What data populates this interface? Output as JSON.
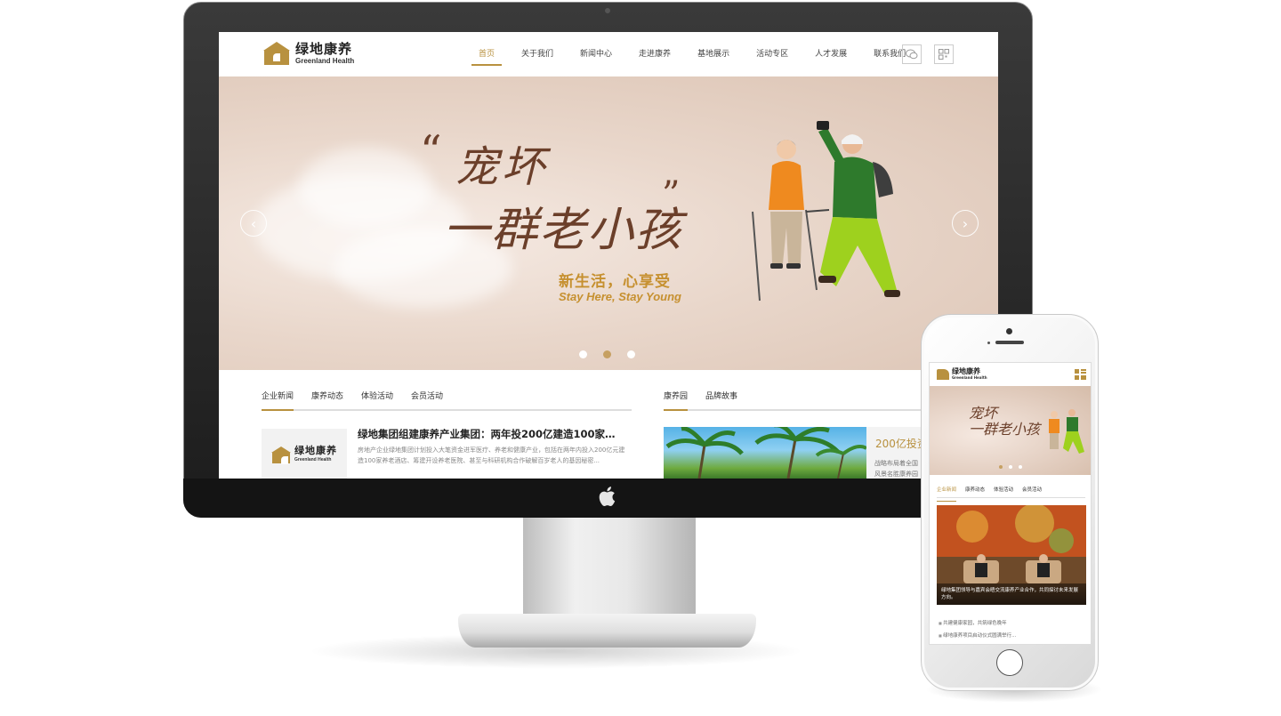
{
  "site": {
    "logo_cn": "绿地康养",
    "logo_en": "Greenland Health",
    "nav": [
      {
        "label": "首页",
        "active": true
      },
      {
        "label": "关于我们",
        "active": false
      },
      {
        "label": "新闻中心",
        "active": false
      },
      {
        "label": "走进康养",
        "active": false
      },
      {
        "label": "基地展示",
        "active": false
      },
      {
        "label": "活动专区",
        "active": false
      },
      {
        "label": "人才发展",
        "active": false
      },
      {
        "label": "联系我们",
        "active": false
      }
    ],
    "header_icons": [
      "wechat-icon",
      "qrcode-icon"
    ]
  },
  "banner": {
    "calligraphy_line1": "宠坏",
    "calligraphy_line2": "一群老小孩",
    "slogan_cn": "新生活，心享受",
    "slogan_en": "Stay Here, Stay Young",
    "prev_icon": "‹",
    "next_icon": "›",
    "slides": 3,
    "active_slide": 2
  },
  "news": {
    "tabs": [
      "企业新闻",
      "康养动态",
      "体验活动",
      "会员活动"
    ],
    "active_tab": 0,
    "item_title": "绿地集团组建康养产业集团：两年投200亿建造100家养老...",
    "item_desc": "房地产企业绿地集团计划投入大笔资金进军医疗、养老和健康产业，包括在两年内投入200亿元建造100家养老酒店、筹建开设养老医院、甚至与科研机构合作破解百岁老人的基因秘密..."
  },
  "right_section": {
    "tabs": [
      "康养园",
      "品牌故事"
    ],
    "active_tab": 0,
    "feature_title": "200亿投资",
    "feature_desc_1": "战略布局着全国",
    "feature_desc_2": "风景名胜康养园"
  },
  "mobile": {
    "logo_cn": "绿地康养",
    "logo_en": "Greenland Health",
    "calligraphy_line1": "宠坏",
    "calligraphy_line2": "一群老小孩",
    "tabs": [
      "企业新闻",
      "康养动态",
      "体验活动",
      "会员活动"
    ],
    "active_tab": 0,
    "photo_caption": "绿地集团领导与嘉宾会晤交流康养产业合作，共同探讨未来发展方向。",
    "list": [
      "共建健康家园，共筑绿色晚年",
      "绿地康养项目启动仪式圆满举行..."
    ],
    "slides": 3,
    "active_slide": 0
  },
  "colors": {
    "accent": "#b8913f",
    "banner_bg": "#e9d7cb",
    "calligraphy": "#6b3f2a",
    "slogan": "#c6902f"
  }
}
